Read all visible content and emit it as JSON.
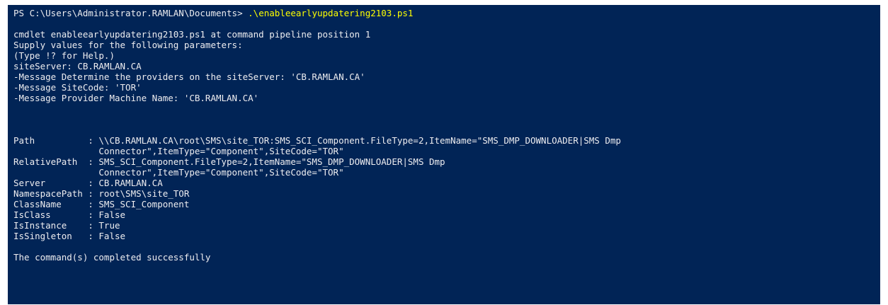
{
  "colors": {
    "background": "#012456",
    "foreground": "#eeedf0",
    "command": "#ffff00"
  },
  "lines": [
    {
      "type": "prompt",
      "prompt": "PS C:\\Users\\Administrator.RAMLAN\\Documents> ",
      "command": ".\\enableearlyupdatering2103.ps1"
    },
    {
      "type": "blank"
    },
    {
      "type": "text",
      "text": "cmdlet enableearlyupdatering2103.ps1 at command pipeline position 1"
    },
    {
      "type": "text",
      "text": "Supply values for the following parameters:"
    },
    {
      "type": "text",
      "text": "(Type !? for Help.)"
    },
    {
      "type": "input",
      "label": "siteServer: ",
      "value": "CB.RAMLAN.CA"
    },
    {
      "type": "text",
      "text": "-Message Determine the providers on the siteServer: 'CB.RAMLAN.CA'"
    },
    {
      "type": "text",
      "text": "-Message SiteCode: 'TOR'"
    },
    {
      "type": "text",
      "text": "-Message Provider Machine Name: 'CB.RAMLAN.CA'"
    },
    {
      "type": "blank"
    },
    {
      "type": "blank"
    },
    {
      "type": "blank"
    },
    {
      "type": "text",
      "text": "Path          : \\\\CB.RAMLAN.CA\\root\\SMS\\site_TOR:SMS_SCI_Component.FileType=2,ItemName=\"SMS_DMP_DOWNLOADER|SMS Dmp"
    },
    {
      "type": "text",
      "text": "                Connector\",ItemType=\"Component\",SiteCode=\"TOR\""
    },
    {
      "type": "text",
      "text": "RelativePath  : SMS_SCI_Component.FileType=2,ItemName=\"SMS_DMP_DOWNLOADER|SMS Dmp"
    },
    {
      "type": "text",
      "text": "                Connector\",ItemType=\"Component\",SiteCode=\"TOR\""
    },
    {
      "type": "text",
      "text": "Server        : CB.RAMLAN.CA"
    },
    {
      "type": "text",
      "text": "NamespacePath : root\\SMS\\site_TOR"
    },
    {
      "type": "text",
      "text": "ClassName     : SMS_SCI_Component"
    },
    {
      "type": "text",
      "text": "IsClass       : False"
    },
    {
      "type": "text",
      "text": "IsInstance    : True"
    },
    {
      "type": "text",
      "text": "IsSingleton   : False"
    },
    {
      "type": "blank"
    },
    {
      "type": "text",
      "text": "The command(s) completed successfully"
    }
  ]
}
